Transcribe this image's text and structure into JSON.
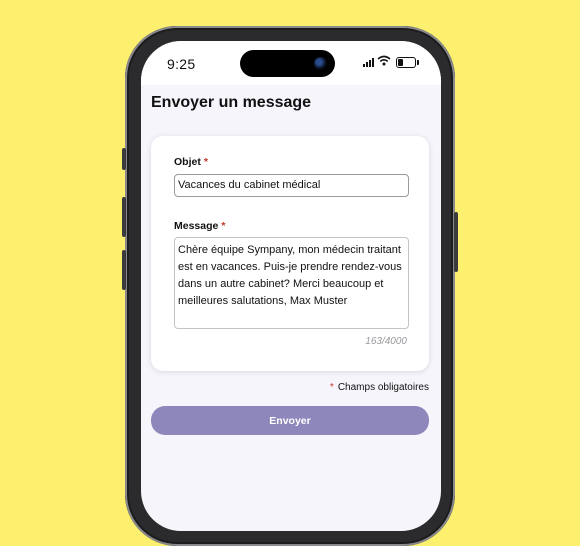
{
  "status_bar": {
    "time": "9:25"
  },
  "page": {
    "title": "Envoyer un message"
  },
  "form": {
    "subject": {
      "label": "Objet",
      "required_mark": "*",
      "value": "Vacances du cabinet médical"
    },
    "message": {
      "label": "Message",
      "required_mark": "*",
      "value": "Chère équipe Sympany, mon médecin traitant est en vacances. Puis-je prendre rendez-vous dans un autre cabinet? Merci beaucoup et meilleures salutations, Max Muster",
      "counter": "163/4000"
    },
    "required_note": {
      "mark": "*",
      "text": "Champs obligatoires"
    },
    "submit_label": "Envoyer"
  },
  "colors": {
    "background": "#FDF06E",
    "primary_button": "#8E87BC",
    "required": "#C0392B"
  }
}
